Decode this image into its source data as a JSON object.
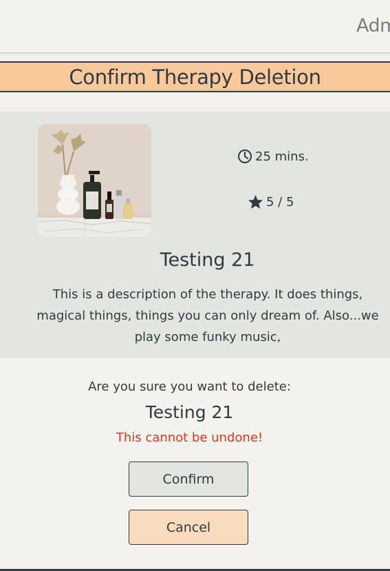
{
  "nav": {
    "admin_label": "Adm"
  },
  "page": {
    "title": "Confirm Therapy Deletion"
  },
  "therapy": {
    "duration": "25 mins.",
    "rating": "5 / 5",
    "name": "Testing 21",
    "description": "This is a description of the therapy. It does things, magical things, things you can only dream of. Also...we play some funky music,",
    "image_icon": "skincare-products-photo"
  },
  "confirmation": {
    "question": "Are you sure you want to delete:",
    "item_name": "Testing 21",
    "warning": "This cannot be undone!"
  },
  "buttons": {
    "confirm_label": "Confirm",
    "cancel_label": "Cancel"
  },
  "colors": {
    "accent": "#f9c99b",
    "card_bg": "#e3e6e0",
    "warning": "#d9391f",
    "text": "#2f3b40"
  }
}
